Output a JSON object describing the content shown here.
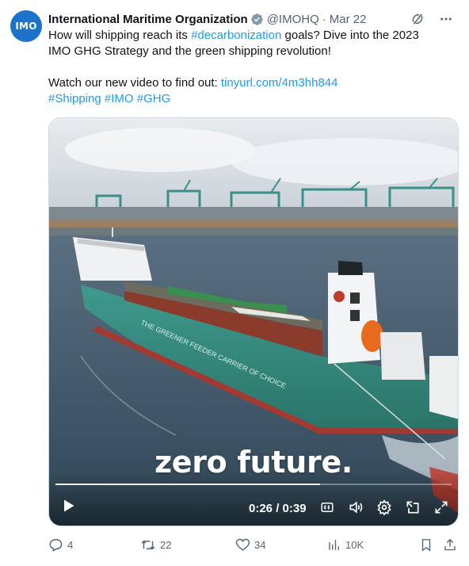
{
  "author": {
    "avatar_text": "IMO",
    "name": "International Maritime Organization",
    "handle": "@IMOHQ",
    "separator": "·",
    "date": "Mar 22"
  },
  "tweet": {
    "line1_pre": "How will shipping reach its ",
    "line1_hashtag": "#decarbonization",
    "line1_post": " goals?  Dive into the 2023",
    "line2": "IMO GHG Strategy and the green shipping revolution!",
    "line4_pre": "Watch our new video to find out: ",
    "line4_link": "tinyurl.com/4m3hh844",
    "hashtag1": "#Shipping",
    "hashtag2": "#IMO",
    "hashtag3": "#GHG"
  },
  "video": {
    "caption": "zero future.",
    "hull_text": "THE GREENER FEEDER CARRIER OF CHOICE",
    "time": "0:26 / 0:39",
    "progress": 0.667
  },
  "actions": {
    "replies": "4",
    "reposts": "22",
    "likes": "34",
    "views": "10K"
  },
  "icons": {
    "verified": "verified-badge-icon",
    "grok": "grok-icon",
    "more": "more-icon",
    "play": "play-icon",
    "cc": "closed-captions-icon",
    "volume": "volume-icon",
    "settings": "gear-icon",
    "popout": "popout-icon",
    "fullscreen": "fullscreen-icon"
  },
  "colors": {
    "link": "#1d9bf0",
    "muted": "#536471",
    "verified_fill": "#829aab",
    "avatar": "#1d72c9"
  }
}
